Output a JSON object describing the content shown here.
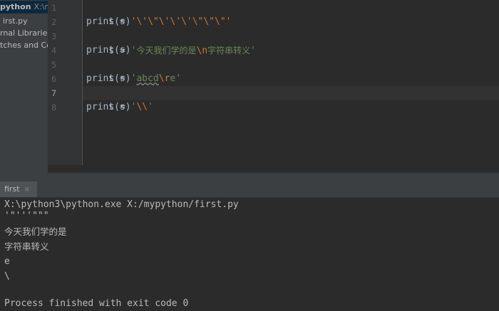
{
  "project_panel": {
    "root_name": "python",
    "root_path": "X:\\my",
    "items": [
      "irst.py",
      "rnal Libraries",
      "tches and Co"
    ]
  },
  "editor": {
    "line_numbers": [
      "1",
      "2",
      "3",
      "4",
      "5",
      "6",
      "7",
      "8"
    ],
    "current_line": 7,
    "lines": {
      "l1": {
        "prefix": "s = ",
        "string": "'\\'\\\"\\'\\'\\'\\\"\\\"\\\"'"
      },
      "l2": {
        "text": "print(s)"
      },
      "l3": {
        "prefix": "s = ",
        "q1": "'",
        "part1": "今天我们学的是",
        "esc": "\\n",
        "part2": "字符串转义",
        "q2": "'"
      },
      "l4": {
        "text": "print(s)"
      },
      "l5": {
        "prefix": "s = ",
        "q1": "'",
        "part1": "abcd",
        "esc": "\\r",
        "part2": "e",
        "q2": "'"
      },
      "l6": {
        "text": "print(s)"
      },
      "l7": {
        "prefix": "s = ",
        "q1": "'",
        "esc": "\\\\",
        "q2": "'"
      },
      "l8": {
        "text": "print(s)"
      }
    }
  },
  "run_panel": {
    "tab_label": "first",
    "tab_close": "×",
    "console_lines": [
      "X:\\python3\\python.exe X:/mypython/first.py",
      "'\"'''\"\"\"",
      "今天我们学的是",
      "字符串转义",
      "e",
      "\\",
      "",
      "Process finished with exit code 0"
    ]
  },
  "colors": {
    "editor_bg": "#2b2b2b",
    "gutter_bg": "#313335",
    "panel_bg": "#3c3f41",
    "string": "#6a8759",
    "escape": "#cc7832",
    "code_text": "#a9b7c6"
  }
}
